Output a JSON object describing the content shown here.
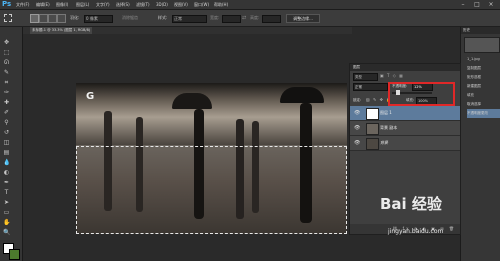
{
  "app": {
    "logo": "Ps"
  },
  "menubar": {
    "items": [
      "文件(F)",
      "编辑(E)",
      "图像(I)",
      "图层(L)",
      "文字(Y)",
      "选择(S)",
      "滤镜(T)",
      "3D(D)",
      "视图(V)",
      "窗口(W)",
      "帮助(H)"
    ]
  },
  "options": {
    "feather_label": "羽化:",
    "feather_value": "0 像素",
    "antialias_label": "消除锯齿",
    "style_label": "样式:",
    "style_value": "正常",
    "width_label": "宽度:",
    "height_label": "高度:",
    "refine_button": "调整边缘..."
  },
  "document": {
    "tab_label": "未标题-1 @ 33.3% (图层 1, RGB/8)"
  },
  "layers_panel": {
    "title": "图层",
    "kind_label": "类型",
    "blend_mode": "正常",
    "opacity_label": "不透明度:",
    "opacity_value": "12%",
    "lock_label": "锁定:",
    "fill_label": "填充:",
    "fill_value": "100%",
    "layers": [
      {
        "name": "图层 1",
        "selected": true
      },
      {
        "name": "背景 副本",
        "selected": false
      },
      {
        "name": "背景",
        "selected": false
      }
    ]
  },
  "right_dock": {
    "history_title": "历史",
    "history_items": [
      "1_1.jpg",
      "复制图层",
      "矩形选框",
      "新建图层",
      "填充",
      "取消选择",
      "不透明度更改"
    ]
  },
  "watermark": {
    "brand": "Bai 经验",
    "url": "jingyan.baidu.com"
  },
  "colors": {
    "accent": "#e02828",
    "ps_blue": "#4cb4f4",
    "selected_layer": "#5d7b9c"
  }
}
